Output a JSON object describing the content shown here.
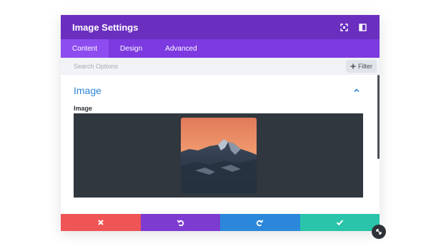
{
  "modal": {
    "title": "Image Settings"
  },
  "tabs": [
    {
      "label": "Content"
    },
    {
      "label": "Design"
    },
    {
      "label": "Advanced"
    }
  ],
  "search": {
    "placeholder": "Search Options"
  },
  "filter": {
    "label": "Filter"
  },
  "section": {
    "title": "Image"
  },
  "field": {
    "label": "Image"
  },
  "colors": {
    "header": "#6a2fbf",
    "tabs": "#7c3ae0",
    "cancel": "#ef5555",
    "undo": "#7e3bd0",
    "redo": "#2b87da",
    "save": "#29c4a9"
  },
  "icons": [
    "expand-icon",
    "sidebar-icon",
    "plus-icon",
    "chevron-up-icon",
    "close-icon",
    "undo-icon",
    "redo-icon",
    "check-icon",
    "resize-icon"
  ]
}
